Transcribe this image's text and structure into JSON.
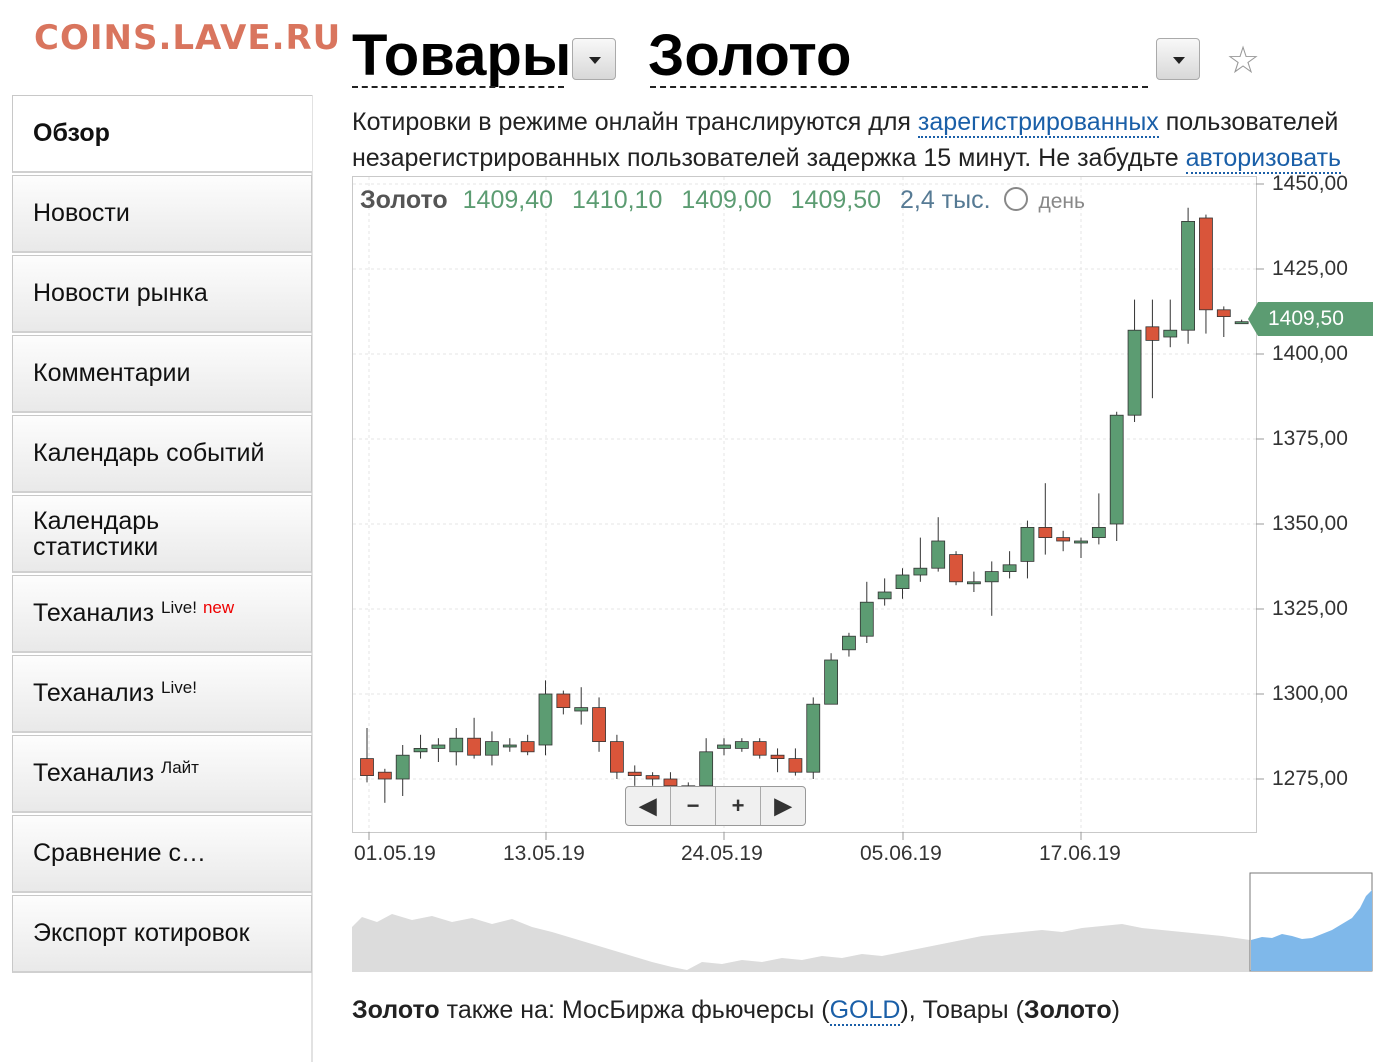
{
  "watermark": "COINS.LAVE.RU",
  "sidebar": {
    "items": [
      {
        "label": "Обзор"
      },
      {
        "label": "Новости"
      },
      {
        "label": "Новости рынка"
      },
      {
        "label": "Комментарии"
      },
      {
        "label": "Календарь событий"
      },
      {
        "label": "Календарь статистики"
      },
      {
        "label": "Теханализ",
        "sup": "Live!",
        "badge": "new"
      },
      {
        "label": "Теханализ",
        "sup": "Live!"
      },
      {
        "label": "Теханализ",
        "sup": "Лайт"
      },
      {
        "label": "Сравнение с…"
      },
      {
        "label": "Экспорт котировок"
      }
    ]
  },
  "header": {
    "category": "Товары",
    "instrument": "Золото"
  },
  "notice": {
    "line1_pre": "Котировки в режиме онлайн транслируются для ",
    "line1_link": "зарегистрированных",
    "line1_post": " пользователей",
    "line2_pre": "незарегистрированных пользователей задержка 15 минут. Не забудьте ",
    "line2_link": "авторизовать"
  },
  "legend": {
    "name": "Золото",
    "open": "1409,40",
    "high": "1410,10",
    "low": "1409,00",
    "close": "1409,50",
    "volume": "2,4 тыс.",
    "period": "день"
  },
  "price_tag": "1409,50",
  "nav_buttons": [
    "◀",
    "−",
    "+",
    "▶"
  ],
  "colors": {
    "up": "#5c9c72",
    "down": "#d9553a",
    "link": "#1a5fa8",
    "navigator": "#7fb8ea"
  },
  "chart_data": {
    "type": "candlestick",
    "x_labels": [
      "01.05.19",
      "13.05.19",
      "24.05.19",
      "05.06.19",
      "17.06.19"
    ],
    "y_labels": [
      "1450,00",
      "1425,00",
      "1400,00",
      "1375,00",
      "1350,00",
      "1325,00",
      "1300,00",
      "1275,00"
    ],
    "ylim": [
      1266,
      1452
    ],
    "candles": [
      [
        1281,
        1276,
        1290,
        1274
      ],
      [
        1277,
        1275,
        1278,
        1268
      ],
      [
        1275,
        1282,
        1285,
        1270
      ],
      [
        1283,
        1284,
        1288,
        1281
      ],
      [
        1284,
        1285,
        1287,
        1280
      ],
      [
        1283,
        1287,
        1290,
        1279
      ],
      [
        1287,
        1282,
        1293,
        1281
      ],
      [
        1282,
        1286,
        1289,
        1279
      ],
      [
        1285,
        1285,
        1287,
        1283
      ],
      [
        1286,
        1283,
        1288,
        1282
      ],
      [
        1285,
        1300,
        1304,
        1282
      ],
      [
        1300,
        1296,
        1301,
        1294
      ],
      [
        1295,
        1296,
        1302,
        1291
      ],
      [
        1296,
        1286,
        1299,
        1283
      ],
      [
        1286,
        1277,
        1288,
        1275
      ],
      [
        1277,
        1276,
        1279,
        1273
      ],
      [
        1276,
        1275,
        1277,
        1273
      ],
      [
        1275,
        1273,
        1277,
        1272
      ],
      [
        1273,
        1272,
        1274,
        1271
      ],
      [
        1273,
        1283,
        1287,
        1272
      ],
      [
        1284,
        1285,
        1287,
        1282
      ],
      [
        1284,
        1286,
        1287,
        1283
      ],
      [
        1286,
        1282,
        1287,
        1281
      ],
      [
        1282,
        1281,
        1284,
        1277
      ],
      [
        1281,
        1277,
        1284,
        1276
      ],
      [
        1277,
        1297,
        1299,
        1275
      ],
      [
        1297,
        1310,
        1312,
        1297
      ],
      [
        1313,
        1317,
        1318,
        1311
      ],
      [
        1317,
        1327,
        1333,
        1315
      ],
      [
        1328,
        1330,
        1334,
        1326
      ],
      [
        1331,
        1335,
        1337,
        1328
      ],
      [
        1335,
        1337,
        1346,
        1333
      ],
      [
        1337,
        1345,
        1352,
        1336
      ],
      [
        1341,
        1333,
        1342,
        1332
      ],
      [
        1333,
        1333,
        1336,
        1330
      ],
      [
        1333,
        1336,
        1339,
        1323
      ],
      [
        1336,
        1338,
        1342,
        1334
      ],
      [
        1339,
        1349,
        1351,
        1334
      ],
      [
        1349,
        1346,
        1362,
        1341
      ],
      [
        1346,
        1345,
        1348,
        1342
      ],
      [
        1345,
        1345,
        1346,
        1340
      ],
      [
        1346,
        1349,
        1359,
        1344
      ],
      [
        1350,
        1382,
        1383,
        1345
      ],
      [
        1382,
        1407,
        1416,
        1380
      ],
      [
        1408,
        1404,
        1416,
        1387
      ],
      [
        1405,
        1407,
        1416,
        1402
      ],
      [
        1407,
        1439,
        1443,
        1403
      ],
      [
        1440,
        1413,
        1441,
        1406
      ],
      [
        1413,
        1411,
        1414,
        1405
      ],
      [
        1409.4,
        1409.5,
        1410.1,
        1409.0
      ]
    ]
  },
  "also": {
    "name": "Золото",
    "text": " также на:  МосБиржа фьючерсы (",
    "link": "GOLD",
    "text2": "), Товары (",
    "name2": "Золото",
    "text3": ")"
  }
}
